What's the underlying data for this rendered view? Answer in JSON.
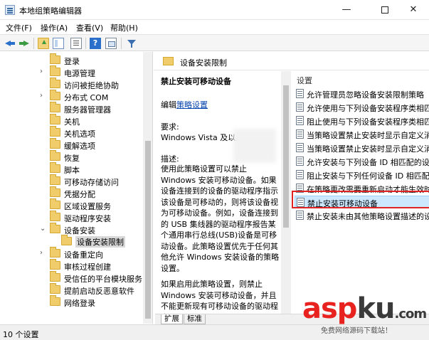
{
  "window": {
    "title": "本地组策略编辑器",
    "min_glyph": "—",
    "close_glyph": "✕"
  },
  "menu": [
    "文件(F)",
    "操作(A)",
    "查看(V)",
    "帮助(H)"
  ],
  "toolbar": {
    "help_glyph": "?"
  },
  "tree": {
    "items": [
      {
        "label": "登录",
        "expandable": false
      },
      {
        "label": "电源管理",
        "expandable": true
      },
      {
        "label": "访问被拒绝协助",
        "expandable": false
      },
      {
        "label": "分布式 COM",
        "expandable": true
      },
      {
        "label": "服务器管理器",
        "expandable": false
      },
      {
        "label": "关机",
        "expandable": false
      },
      {
        "label": "关机选项",
        "expandable": false
      },
      {
        "label": "缓解选项",
        "expandable": false
      },
      {
        "label": "恢复",
        "expandable": false
      },
      {
        "label": "脚本",
        "expandable": false
      },
      {
        "label": "可移动存储访问",
        "expandable": false
      },
      {
        "label": "凭据分配",
        "expandable": false
      },
      {
        "label": "区域设置服务",
        "expandable": false
      },
      {
        "label": "驱动程序安装",
        "expandable": false
      },
      {
        "label": "设备安装",
        "expandable": true,
        "expanded": true
      },
      {
        "label": "设备安装限制",
        "expandable": false,
        "child": true,
        "selected": true
      },
      {
        "label": "设备重定向",
        "expandable": true
      },
      {
        "label": "审核过程创建",
        "expandable": false
      },
      {
        "label": "受信任的平台模块服务",
        "expandable": false
      },
      {
        "label": "提前启动反恶意软件",
        "expandable": false
      },
      {
        "label": "网络登录",
        "expandable": false
      }
    ]
  },
  "header": {
    "title": "设备安装限制"
  },
  "description": {
    "title": "禁止安装可移动设备",
    "edit_prefix": "编辑",
    "edit_link": "策略设置",
    "requirements_label": "要求:",
    "requirements": "Windows Vista 及以上版本",
    "description_label": "描述:",
    "para1": "使用此策略设置可以禁止 Windows 安装可移动设备。如果设备连接到的设备的驱动程序指示该设备是可移动的，则将该设备视为可移动设备。例如，设备连接到的 USB 集线器的驱动程序报告某个通用串行总线(USB)设备是可移动设备。此策略设置优先于任何其他允许 Windows 安装设备的策略设置。",
    "para2": "如果启用此策略设置，则禁止 Windows 安装可移动设备，并且不能更新现有可移动设备的驱动程序。"
  },
  "list": {
    "header": "设置",
    "items": [
      "允许管理员忽略设备安装限制策略",
      "允许使用与下列设备安装程序类相匹配的驱动程序安装设备",
      "阻止使用与下列设备安装程序类相匹配的驱动程序安装设备",
      "当策略设置禁止安装时显示自定义消息",
      "当策略设置禁止安装时显示自定义消息标题",
      "允许安装与下列设备 ID 相匹配的设备",
      "阻止安装与下列任何设备 ID 相匹配的设备",
      "在策略更改需要重新启动才能生效时",
      "禁止安装可移动设备",
      "禁止安装未由其他策略设置描述的设备"
    ],
    "selected_index": 8
  },
  "tabs": {
    "extended": "扩展",
    "standard": "标准"
  },
  "status": {
    "text": "10 个设置"
  },
  "watermark": {
    "brand_a": "asp",
    "brand_b": "ku",
    "brand_c": ".com",
    "tagline": "免费网络源码下载站！"
  },
  "colors": {
    "highlight_border": "#e02424",
    "selection_fill": "#cce8ff",
    "link": "#0645ad"
  }
}
